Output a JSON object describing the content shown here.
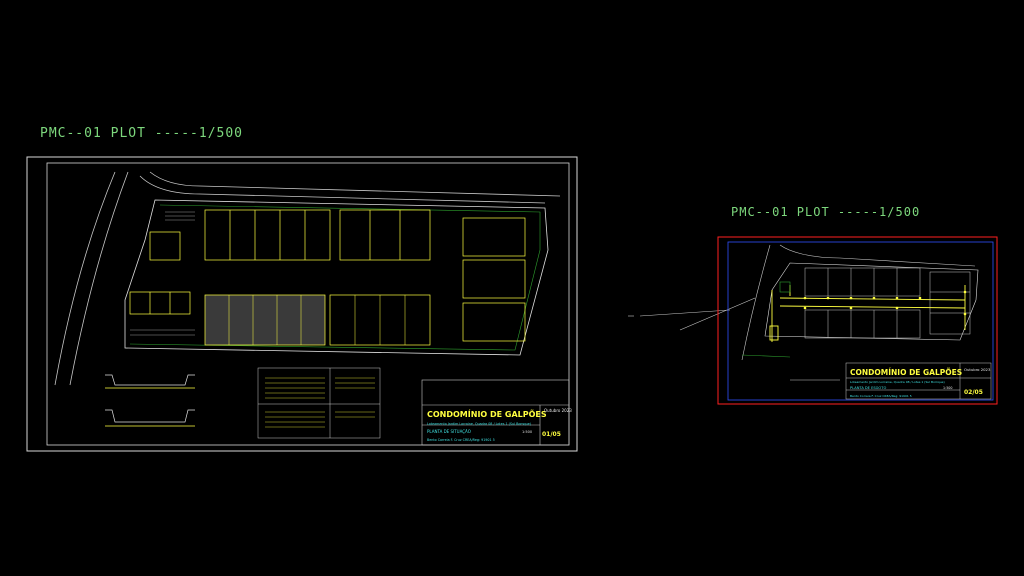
{
  "sheet1": {
    "plot_label": "PMC--01 PLOT -----1/500",
    "title": "CONDOMÍNIO DE GALPÕES",
    "sheet_number": "01/05",
    "drawing_name": "PLANTA DE SITUAÇÃO",
    "scale": "1:500",
    "date": "Outubro 2023",
    "subtitle": "Loteamento Jardim Lorraine, Quadra 08 / Lotes 1 (Sul Bomque)",
    "footer": "Bento Correia F. Cruz   CREA/Reg: 91901 5"
  },
  "sheet2": {
    "plot_label": "PMC--01 PLOT -----1/500",
    "title": "CONDOMÍNIO DE GALPÕES",
    "sheet_number": "02/05",
    "drawing_name": "PLANTA DE ESGOTO",
    "scale": "1:500",
    "date": "Outubro 2023",
    "subtitle": "Loteamento Jardim Lorraine, Quadra 08 / Lotes 1 (Sul Bomque)",
    "footer": "Bento Correia F. Cruz   CREA/Reg: 91901 5"
  },
  "colors": {
    "background": "#000000",
    "plot_label": "#7dd87d",
    "frame": "#ffffff",
    "building": "#ffff40",
    "selection": "#ff2020",
    "accent_blue": "#3050ff"
  }
}
